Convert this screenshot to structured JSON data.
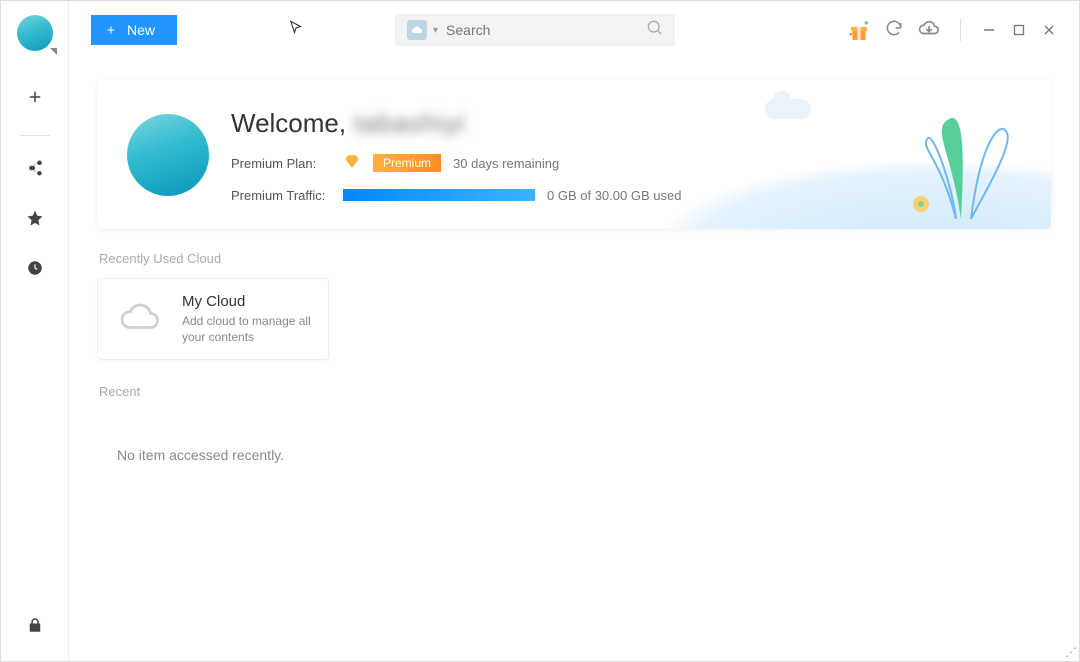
{
  "topbar": {
    "new_label": "New",
    "search_placeholder": "Search"
  },
  "welcome": {
    "greeting_prefix": "Welcome,",
    "username": "tabashiyi",
    "plan_label": "Premium Plan:",
    "badge_text": "Premium",
    "remaining": "30 days remaining",
    "traffic_label": "Premium Traffic:",
    "traffic_used": "0 GB of 30.00 GB used"
  },
  "sections": {
    "recently_used_cloud": "Recently Used Cloud",
    "recent": "Recent"
  },
  "cloud_card": {
    "title": "My Cloud",
    "desc": "Add cloud to manage all your contents"
  },
  "empty_state": "No item accessed recently."
}
